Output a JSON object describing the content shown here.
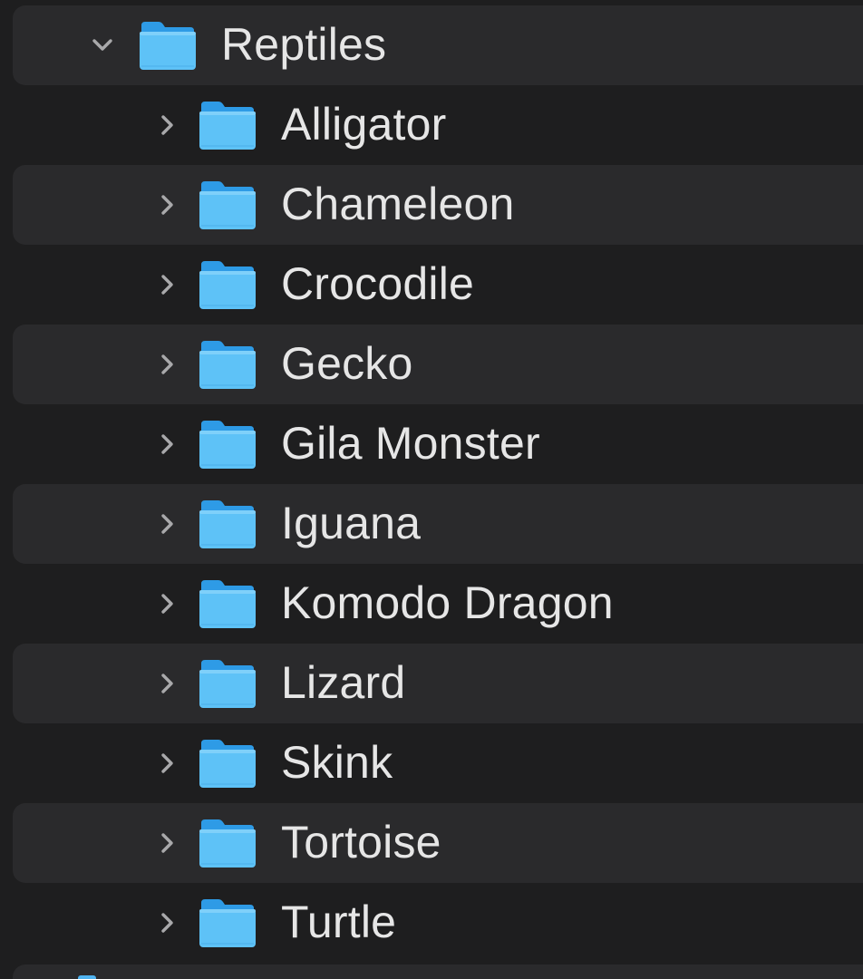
{
  "colors": {
    "background": "#1e1e1f",
    "row_stripe": "#2a2a2c",
    "text": "#e6e6e6",
    "chevron": "#a9a9ab",
    "folder_back": "#2e9be6",
    "folder_front": "#5ec2f7"
  },
  "icons": {
    "expanded": "chevron-down-icon",
    "collapsed": "chevron-right-icon",
    "folder": "folder-icon"
  },
  "tree": {
    "root": {
      "label": "Reptiles",
      "expanded": true
    },
    "children": [
      {
        "label": "Alligator",
        "expanded": false
      },
      {
        "label": "Chameleon",
        "expanded": false
      },
      {
        "label": "Crocodile",
        "expanded": false
      },
      {
        "label": "Gecko",
        "expanded": false
      },
      {
        "label": "Gila Monster",
        "expanded": false
      },
      {
        "label": "Iguana",
        "expanded": false
      },
      {
        "label": "Komodo Dragon",
        "expanded": false
      },
      {
        "label": "Lizard",
        "expanded": false
      },
      {
        "label": "Skink",
        "expanded": false
      },
      {
        "label": "Tortoise",
        "expanded": false
      },
      {
        "label": "Turtle",
        "expanded": false
      }
    ]
  }
}
